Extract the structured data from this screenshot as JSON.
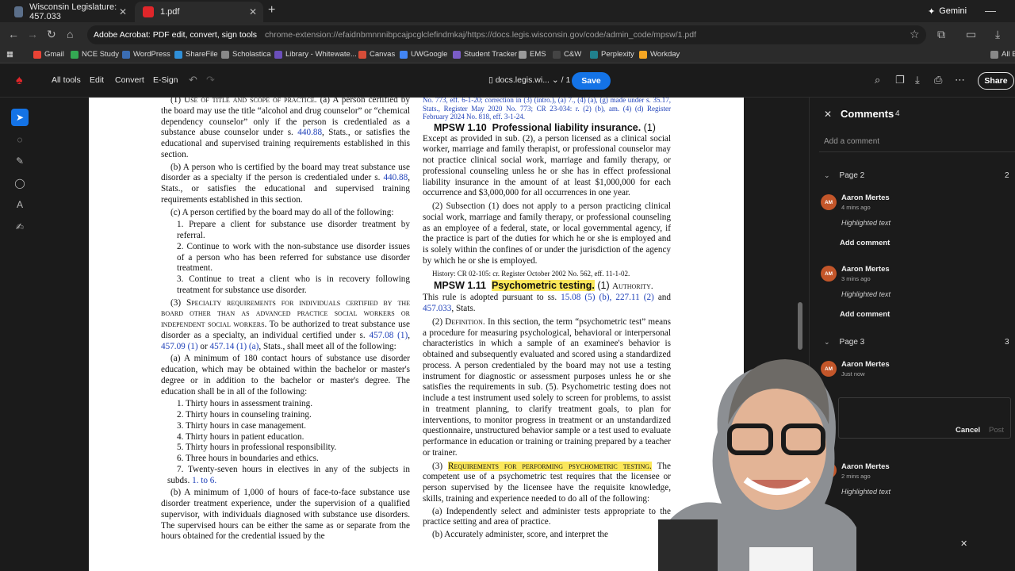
{
  "browser": {
    "tabs": [
      {
        "title": "Wisconsin Legislature: 457.033",
        "active": false
      },
      {
        "title": "1.pdf",
        "active": true
      }
    ],
    "gemini_label": "Gemini",
    "url_site": "Adobe Acrobat: PDF edit, convert, sign tools",
    "url_path": "chrome-extension://efaidnbmnnnibpcajpcglclefindmkaj/https://docs.legis.wisconsin.gov/code/admin_code/mpsw/1.pdf",
    "bookmarks": [
      {
        "label": "Gmail",
        "color": "#ea4335"
      },
      {
        "label": "NCE Study",
        "color": "#34a853"
      },
      {
        "label": "WordPress",
        "color": "#3b6db3"
      },
      {
        "label": "ShareFile",
        "color": "#2f8fd8"
      },
      {
        "label": "Scholastica",
        "color": "#888888"
      },
      {
        "label": "Library - Whitewate...",
        "color": "#6b4fbb"
      },
      {
        "label": "Canvas",
        "color": "#d64d38"
      },
      {
        "label": "UWGoogle",
        "color": "#4285f4"
      },
      {
        "label": "Student Tracker",
        "color": "#7a5cc6"
      },
      {
        "label": "EMS",
        "color": "#999999"
      },
      {
        "label": "C&W",
        "color": "#444444"
      },
      {
        "label": "Perplexity",
        "color": "#20808d"
      },
      {
        "label": "Workday",
        "color": "#f5a623"
      }
    ],
    "all_bookmarks": "All B"
  },
  "acrobat": {
    "menu": [
      "All tools",
      "Edit",
      "Convert",
      "E-Sign"
    ],
    "doc_name": "docs.legis.wi...",
    "page_indicator": "/ 1",
    "save_label": "Save",
    "share_label": "Share"
  },
  "document": {
    "left": {
      "p1_lead": "(1)",
      "p1_sc": "Use of title and scope of practice.",
      "p1_text": " (a) A person certified by the board may use the title “alcohol and drug counselor” or “chemical dependency counselor” only if the person is credentialed as a substance abuse counselor under s. ",
      "p1_link": "440.88",
      "p1_text2": ", Stats., or satisfies the educational and supervised training requirements established in this section.",
      "p2_text": "(b) A person who is certified by the board may treat substance use disorder as a specialty if the person is credentialed under s. ",
      "p2_link": "440.88",
      "p2_text2": ", Stats., or satisfies the educational and supervised training requirements established in this section.",
      "p3": "(c) A person certified by the board may do all of the following:",
      "list1": [
        "1. Prepare a client for substance use disorder treatment by referral.",
        "2. Continue to work with the non-substance use disorder issues of a person who has been referred for substance use disorder treatment.",
        "3. Continue to treat a client who is in recovery following treatment for substance use disorder."
      ],
      "p4_lead": "(3)",
      "p4_sc": "Specialty requirements for individuals certified by the board other than as advanced practice social workers or independent social workers.",
      "p4_text": " To be authorized to treat substance use disorder as a specialty, an individual certified under s. ",
      "p4_link1": "457.08 (1)",
      "p4_link2": "457.09 (1)",
      "p4_link3": "457.14 (1) (a)",
      "p4_text2": ", Stats., shall meet all of the following:",
      "p5": "(a) A minimum of 180 contact hours of substance use disorder education, which may be obtained within the bachelor or master's degree or in addition to the bachelor or master's degree. The education shall be in all of the following:",
      "list2": [
        "1. Thirty hours in assessment training.",
        "2. Thirty hours in counseling training.",
        "3. Thirty hours in case management.",
        "4. Thirty hours in patient education.",
        "5. Thirty hours in professional responsibility.",
        "6. Three hours in boundaries and ethics.",
        "7. Twenty-seven hours in electives in any of the subjects in subds. "
      ],
      "list2_link": "1. to 6.",
      "p6": "(b) A minimum of 1,000 of hours of face-to-face substance use disorder treatment experience, under the supervision of a qualified supervisor, with individuals diagnosed with substance use disorders. The supervised hours can be either the same as or separate from the hours obtained for the credential issued by the"
    },
    "right": {
      "top_links": "No. 773, eff. 6-1-20; correction in (3) (intro.), (a) 7., (4) (a), (g) made under s. 35.17, Stats., Register May 2020 No. 773; CR 23-034: r. (2) (b), am. (4) (d) Register February 2024 No. 818, eff. 3-1-24.",
      "h110_num": "MPSW 1.10",
      "h110_title": "Professional liability insurance.",
      "h110_lead": " (1) ",
      "s110_p1": "Except as provided in sub. (2), a person licensed as a clinical social worker, marriage and family therapist, or professional counselor may not practice clinical social work, marriage and family therapy, or professional counseling unless he or she has in effect professional liability insurance in the amount of at least $1,000,000 for each occurrence and $3,000,000 for all occurrences in one year.",
      "s110_p2": "(2) Subsection (1) does not apply to a person practicing clinical social work, marriage and family therapy, or professional counseling as an employee of a federal, state, or local governmental agency, if the practice is part of the duties for which he or she is employed and is solely within the confines of or under the jurisdiction of the agency by which he or she is employed.",
      "history": "History: CR 02-105: cr. Register October 2002 No. 562, eff. 11-1-02.",
      "h111_num": "MPSW 1.11",
      "h111_title": "Psychometric testing.",
      "h111_lead": " (1) ",
      "h111_sc": "Authority.",
      "s111_p1": "This rule is adopted pursuant to ss. ",
      "s111_links": "15.08 (5) (b), 227.11 (2)",
      "s111_and": " and ",
      "s111_link2": "457.033",
      "s111_end": ", Stats.",
      "s111_p2_lead": "(2) ",
      "s111_p2_sc": "Definition.",
      "s111_p2": " In this section, the term “psychometric test” means a procedure for measuring psychological, behavioral or interpersonal characteristics in which a sample of an examinee's behavior is obtained and subsequently evaluated and scored using a standardized process. A person credentialed by the board may not use a testing instrument for diagnostic or assessment purposes unless he or she satisfies the requirements in sub. (5). Psychometric testing does not include a test instrument used solely to screen for problems, to assist in treatment planning, to clarify treatment goals, to plan for interventions, to monitor progress in treatment or an unstandardized questionnaire, unstructured behavior sample or a test used to evaluate performance in education or training or training prepared by a teacher or trainer.",
      "s111_p3_lead": "(3) ",
      "s111_p3_sc": "Requirements for performing psychometric testing.",
      "s111_p3": " The competent use of a psychometric test requires that the licensee or person supervised by the licensee have the requisite knowledge, skills, training and experience needed to do all of the following:",
      "s111_a": "(a) Independently select and administer tests appropriate to the practice setting and area of practice.",
      "s111_b": "(b) Accurately administer, score, and interpret the"
    }
  },
  "comments_panel": {
    "title": "Comments",
    "count": "4",
    "add_placeholder": "Add a comment",
    "groups": [
      {
        "label": "Page 2",
        "count": "2",
        "comments": [
          {
            "initials": "AM",
            "author": "Aaron Mertes",
            "time": "4 mins ago",
            "text": "Highlighted text",
            "action": "Add comment"
          },
          {
            "initials": "AM",
            "author": "Aaron Mertes",
            "time": "3 mins ago",
            "text": "Highlighted text",
            "action": "Add comment"
          }
        ]
      },
      {
        "label": "Page 3",
        "count": "3",
        "comments": [
          {
            "initials": "AM",
            "author": "Aaron Mertes",
            "time": "Just now"
          },
          {
            "initials": "AM",
            "author": "Aaron Mertes",
            "time": "2 mins ago",
            "text": "Highlighted text"
          }
        ]
      }
    ],
    "cancel_label": "Cancel",
    "post_label": "Post"
  }
}
